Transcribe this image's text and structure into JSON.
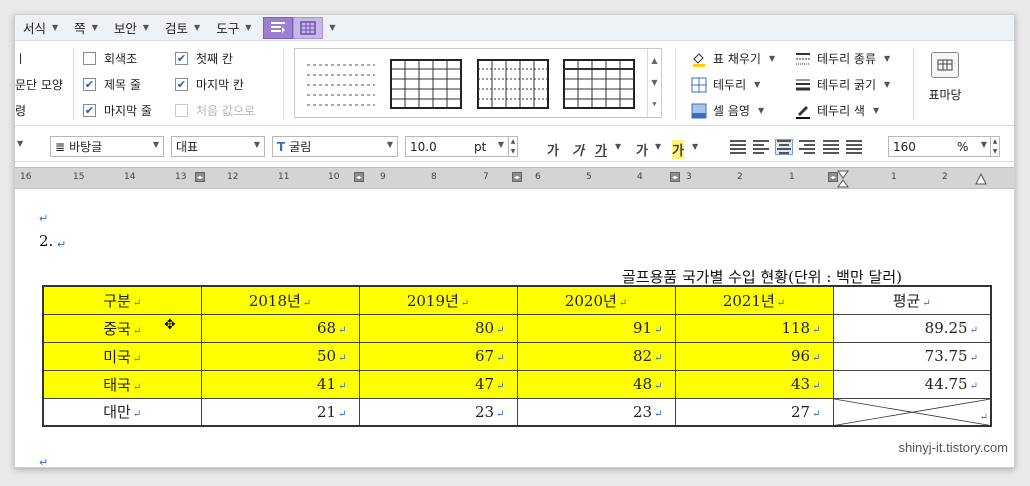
{
  "menu": {
    "items": [
      "서식",
      "쪽",
      "보안",
      "검토",
      "도구"
    ]
  },
  "ribbon": {
    "partial_left": [
      "ㅣ",
      "문단 모양",
      "령"
    ],
    "checkboxes_col1": [
      {
        "label": "회색조",
        "checked": false
      },
      {
        "label": "제목 줄",
        "checked": true
      },
      {
        "label": "마지막 줄",
        "checked": true
      }
    ],
    "checkboxes_col2": [
      {
        "label": "첫째 칸",
        "checked": true
      },
      {
        "label": "마지막 칸",
        "checked": true
      },
      {
        "label": "처음 값으로",
        "checked": false
      }
    ],
    "commands_col1": [
      "표 채우기",
      "테두리",
      "셀 음영"
    ],
    "commands_col2": [
      "테두리 종류",
      "테두리 굵기",
      "테두리 색"
    ],
    "big_button": "표마당"
  },
  "formatbar": {
    "style": "바탕글",
    "language": "대표",
    "font": "굴림",
    "size_value": "10.0",
    "size_unit": "pt",
    "zoom_value": "160",
    "zoom_unit": "%",
    "text_buttons": [
      "가",
      "가",
      "가",
      "가",
      "가"
    ]
  },
  "ruler": {
    "numbers": [
      "16",
      "15",
      "14",
      "13",
      "12",
      "11",
      "10",
      "9",
      "8",
      "7",
      "6",
      "5",
      "4",
      "3",
      "2",
      "1",
      "1",
      "2"
    ]
  },
  "document": {
    "heading_number": "2.",
    "caption": "골프용품 국가별 수입 현황(단위 : 백만 달러)",
    "table": {
      "header": [
        "구분",
        "2018년",
        "2019년",
        "2020년",
        "2021년",
        "평균"
      ],
      "rows": [
        {
          "label": "중국",
          "values": [
            "68",
            "80",
            "91",
            "118"
          ],
          "avg": "89.25"
        },
        {
          "label": "미국",
          "values": [
            "50",
            "67",
            "82",
            "96"
          ],
          "avg": "73.75"
        },
        {
          "label": "태국",
          "values": [
            "41",
            "47",
            "48",
            "43"
          ],
          "avg": "44.75"
        },
        {
          "label": "대만",
          "values": [
            "21",
            "23",
            "23",
            "27"
          ],
          "avg": ""
        }
      ]
    },
    "watermark": "shinyj-it.tistory.com"
  },
  "colors": {
    "highlight": "#ffff00",
    "tab_active": "#9b7fd1",
    "para_mark": "#3a6fc4"
  }
}
